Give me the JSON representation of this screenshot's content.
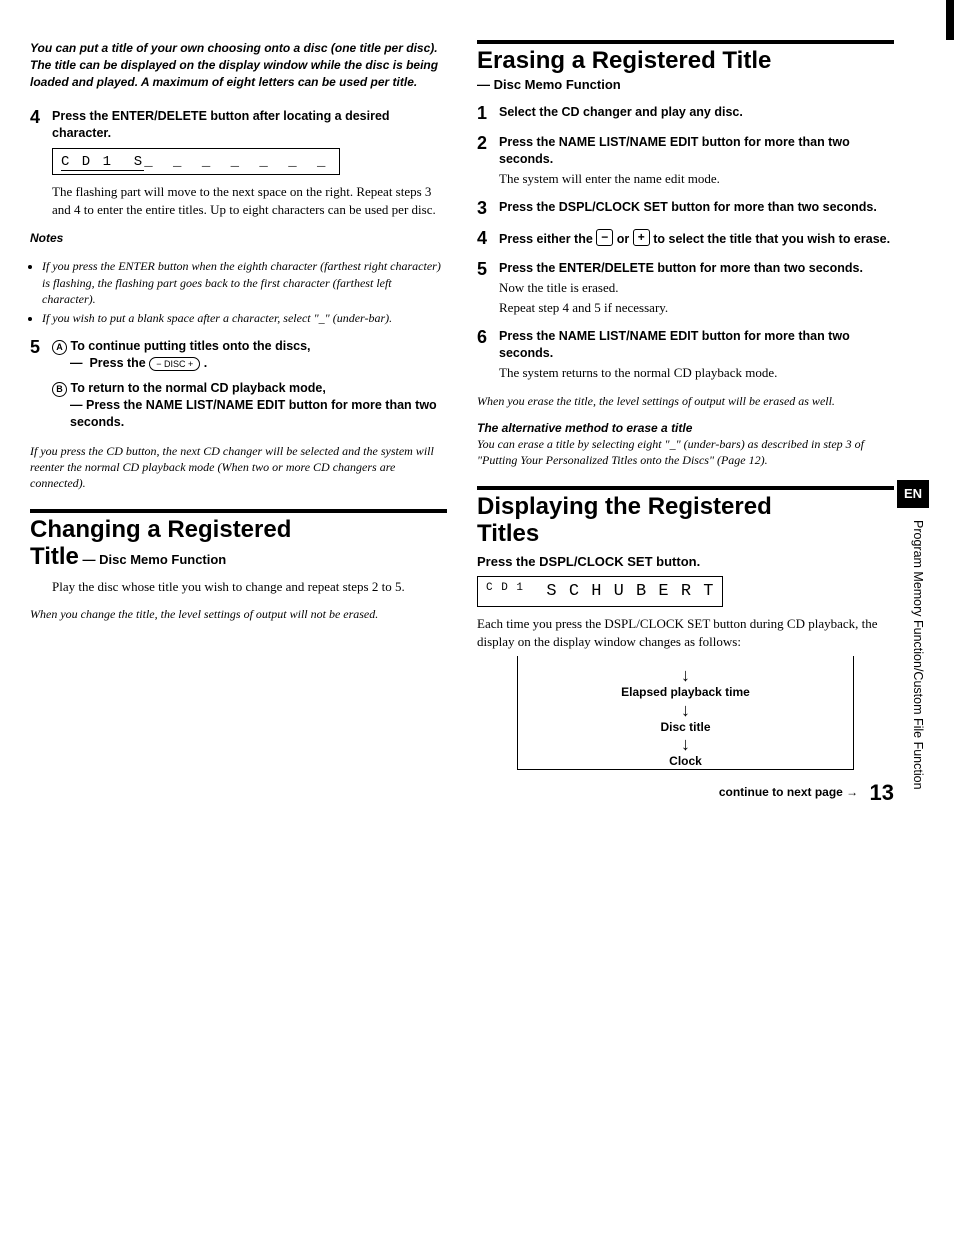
{
  "sideLang": "EN",
  "sideText": "Program Memory Function/Custom File Function",
  "pageNumber": "13",
  "footerText": "continue to next page →",
  "left": {
    "intro": "You can put a title of your own choosing onto a disc (one title per disc). The title can be displayed on the display window while the disc is being loaded and played. A maximum of eight letters can be used per title.",
    "step4": {
      "bold": "Press the ENTER/DELETE button after locating a desired character.",
      "display": "C D 1  S̲ _ _ _ _ _ _ _",
      "text": "The flashing part will move to the next space on the right. Repeat steps 3 and 4 to enter the entire titles. Up to eight characters can be used per disc."
    },
    "notesHead": "Notes",
    "note1": "If you press the ENTER button when the eighth character (farthest right character) is flashing, the flashing part goes back to the first character (farthest left character).",
    "note2": "If you wish to put a blank space after a character, select \"_\" (under-bar).",
    "step5": {
      "aLabel": "To continue putting titles onto the discs,",
      "aPress": "Press the",
      "aBtn": "− DISC +",
      "aDot": ".",
      "bLabel": "To return to the normal CD playback mode,",
      "bPress": "Press the NAME LIST/NAME EDIT button for more than two seconds."
    },
    "tailItal": "If you press the CD button, the next CD changer will be selected and the system will reenter the normal CD playback mode (When two or more CD changers are connected).",
    "h1a": "Changing a Registered",
    "h1b": "Title",
    "h1sub": " — Disc Memo Function",
    "changeText": "Play the disc whose title you wish to change and repeat steps 2 to 5.",
    "changeItal": "When you change the title, the level settings of output will not be erased."
  },
  "right": {
    "h1": "Erasing a Registered Title",
    "sub": "— Disc Memo Function",
    "step1": "Select the CD changer and play any disc.",
    "step2": {
      "bold": "Press the NAME LIST/NAME EDIT button for more than two seconds.",
      "text": "The system will enter the name edit mode."
    },
    "step3": "Press the DSPL/CLOCK SET button for more than two seconds.",
    "step4a": "Press either the ",
    "step4b": " or ",
    "step4c": " to select the title that you wish to erase.",
    "step5": {
      "bold": "Press the ENTER/DELETE button for more than two seconds.",
      "text1": "Now the title is erased.",
      "text2": "Repeat step 4 and 5 if necessary."
    },
    "step6": {
      "bold": "Press the NAME LIST/NAME EDIT button for more than two seconds.",
      "text": "The system returns to the normal CD playback mode."
    },
    "ital1": "When you erase the title, the level settings of output will be erased as well.",
    "altHead": "The alternative method to erase a title",
    "altText": "You can erase a title by selecting eight \"_\" (under-bars) as described in step 3 of \"Putting Your Personalized Titles onto the Discs\" (Page 12).",
    "h2a": "Displaying the Registered",
    "h2b": "Titles",
    "h2sub": "Press the DSPL/CLOCK SET button.",
    "display": "C D 1  S C H U B E R T",
    "dispText": "Each time you press the DSPL/CLOCK SET button during CD playback, the display on the display window changes as follows:",
    "flow1": "Elapsed playback time",
    "flow2": "Disc title",
    "flow3": "Clock"
  }
}
